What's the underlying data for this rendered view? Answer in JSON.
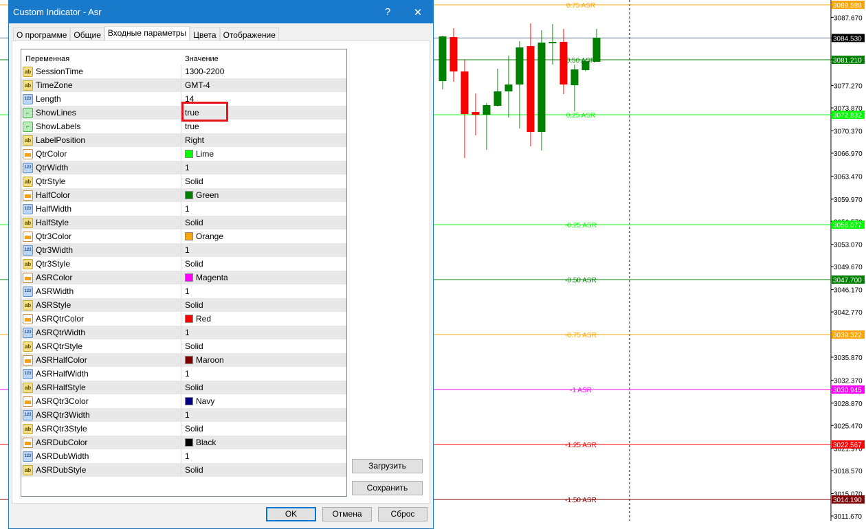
{
  "dialog": {
    "title": "Custom Indicator - Asr",
    "help": "?",
    "close": "✕",
    "tabs": [
      "О программе",
      "Общие",
      "Входные параметры",
      "Цвета",
      "Отображение"
    ],
    "active_tab": 2,
    "columns": {
      "variable": "Переменная",
      "value": "Значение"
    },
    "params": [
      {
        "name": "SessionTime",
        "type": "ab",
        "value": "1300-2200"
      },
      {
        "name": "TimeZone",
        "type": "ab",
        "value": "GMT-4"
      },
      {
        "name": "Length",
        "type": "num",
        "value": "14"
      },
      {
        "name": "ShowLines",
        "type": "bool",
        "value": "true"
      },
      {
        "name": "ShowLabels",
        "type": "bool",
        "value": "true"
      },
      {
        "name": "LabelPosition",
        "type": "ab",
        "value": "Right"
      },
      {
        "name": "QtrColor",
        "type": "color",
        "value": "Lime",
        "swatch": "#00ff00"
      },
      {
        "name": "QtrWidth",
        "type": "num",
        "value": "1"
      },
      {
        "name": "QtrStyle",
        "type": "ab",
        "value": "Solid"
      },
      {
        "name": "HalfColor",
        "type": "color",
        "value": "Green",
        "swatch": "#008000"
      },
      {
        "name": "HalfWidth",
        "type": "num",
        "value": "1"
      },
      {
        "name": "HalfStyle",
        "type": "ab",
        "value": "Solid"
      },
      {
        "name": "Qtr3Color",
        "type": "color",
        "value": "Orange",
        "swatch": "#ffa500"
      },
      {
        "name": "Qtr3Width",
        "type": "num",
        "value": "1"
      },
      {
        "name": "Qtr3Style",
        "type": "ab",
        "value": "Solid"
      },
      {
        "name": "ASRColor",
        "type": "color",
        "value": "Magenta",
        "swatch": "#ff00ff"
      },
      {
        "name": "ASRWidth",
        "type": "num",
        "value": "1"
      },
      {
        "name": "ASRStyle",
        "type": "ab",
        "value": "Solid"
      },
      {
        "name": "ASRQtrColor",
        "type": "color",
        "value": "Red",
        "swatch": "#ff0000"
      },
      {
        "name": "ASRQtrWidth",
        "type": "num",
        "value": "1"
      },
      {
        "name": "ASRQtrStyle",
        "type": "ab",
        "value": "Solid"
      },
      {
        "name": "ASRHalfColor",
        "type": "color",
        "value": "Maroon",
        "swatch": "#800000"
      },
      {
        "name": "ASRHalfWidth",
        "type": "num",
        "value": "1"
      },
      {
        "name": "ASRHalfStyle",
        "type": "ab",
        "value": "Solid"
      },
      {
        "name": "ASRQtr3Color",
        "type": "color",
        "value": "Navy",
        "swatch": "#000080"
      },
      {
        "name": "ASRQtr3Width",
        "type": "num",
        "value": "1"
      },
      {
        "name": "ASRQtr3Style",
        "type": "ab",
        "value": "Solid"
      },
      {
        "name": "ASRDubColor",
        "type": "color",
        "value": "Black",
        "swatch": "#000000"
      },
      {
        "name": "ASRDubWidth",
        "type": "num",
        "value": "1"
      },
      {
        "name": "ASRDubStyle",
        "type": "ab",
        "value": "Solid"
      }
    ],
    "buttons": {
      "load": "Загрузить",
      "save": "Сохранить",
      "ok": "OK",
      "cancel": "Отмена",
      "reset": "Сброс"
    }
  },
  "chart": {
    "price_axis": [
      "3087.670",
      "3084.530",
      "3081.210",
      "3077.270",
      "3073.870",
      "3070.370",
      "3066.970",
      "3063.470",
      "3059.970",
      "3056.570",
      "3053.070",
      "3049.670",
      "3046.170",
      "3042.770",
      "3035.870",
      "3032.370",
      "3028.870",
      "3025.470",
      "3021.970",
      "3018.570",
      "3015.070",
      "3011.670"
    ],
    "bid": {
      "price": "3084.530",
      "color": "#000000"
    },
    "levels": [
      {
        "label": "0.75 ASR",
        "price": "3089.588",
        "color": "#ffa500"
      },
      {
        "label": "0.50 ASR",
        "price": "3081.210",
        "color": "#008000"
      },
      {
        "label": "0.25 ASR",
        "price": "3072.832",
        "color": "#00ff00"
      },
      {
        "label": "-0.25 ASR",
        "price": "3056.077",
        "color": "#00ff00"
      },
      {
        "label": "-0.50 ASR",
        "price": "3047.700",
        "color": "#008000"
      },
      {
        "label": "-0.75 ASR",
        "price": "3039.322",
        "color": "#ffa500"
      },
      {
        "label": "-1 ASR",
        "price": "3030.945",
        "color": "#ff00ff"
      },
      {
        "label": "-1.25 ASR",
        "price": "3022.567",
        "color": "#ff0000"
      },
      {
        "label": "-1.50 ASR",
        "price": "3014.190",
        "color": "#800000"
      }
    ],
    "up_color": "#008000",
    "down_color": "#ff0000",
    "candles": [
      [
        3077.96,
        3084.88,
        3076.71,
        3084.77
      ],
      [
        3084.67,
        3086.03,
        3077.86,
        3079.43
      ],
      [
        3079.43,
        3081.21,
        3066.24,
        3072.94
      ],
      [
        3073.25,
        3076.08,
        3069.69,
        3072.83
      ],
      [
        3072.83,
        3074.61,
        3067.49,
        3074.3
      ],
      [
        3074.19,
        3079.85,
        3074.09,
        3076.39
      ],
      [
        3076.39,
        3081.84,
        3072.41,
        3077.44
      ],
      [
        3077.44,
        3084.04,
        3070.74,
        3083.09
      ],
      [
        3083.3,
        3086.76,
        3068.02,
        3070.21
      ],
      [
        3070.21,
        3085.71,
        3067.39,
        3083.83
      ],
      [
        3083.72,
        3086.66,
        3080.48,
        3083.93
      ],
      [
        3083.93,
        3085.92,
        3075.97,
        3077.44
      ],
      [
        3077.33,
        3080.48,
        3073.36,
        3079.74
      ],
      [
        3079.64,
        3081.21,
        3079.43,
        3081.0
      ],
      [
        3080.9,
        3085.92,
        3080.9,
        3084.56
      ]
    ]
  }
}
